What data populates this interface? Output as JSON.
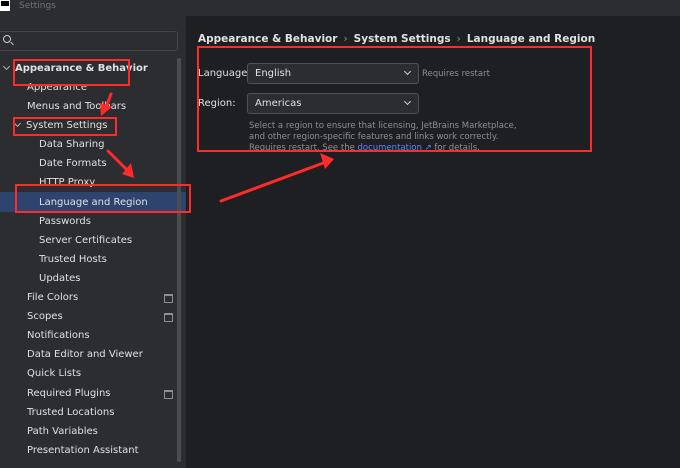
{
  "window": {
    "title": "Settings"
  },
  "search": {
    "placeholder": ""
  },
  "tree": {
    "appearance_behavior": "Appearance & Behavior",
    "appearance": "Appearance",
    "menus_toolbars": "Menus and Toolbars",
    "system_settings": "System Settings",
    "data_sharing": "Data Sharing",
    "date_formats": "Date Formats",
    "http_proxy": "HTTP Proxy",
    "language_region": "Language and Region",
    "passwords": "Passwords",
    "server_certificates": "Server Certificates",
    "trusted_hosts": "Trusted Hosts",
    "updates": "Updates",
    "file_colors": "File Colors",
    "scopes": "Scopes",
    "notifications": "Notifications",
    "data_editor_viewer": "Data Editor and Viewer",
    "quick_lists": "Quick Lists",
    "required_plugins": "Required Plugins",
    "trusted_locations": "Trusted Locations",
    "path_variables": "Path Variables",
    "presentation_assistant": "Presentation Assistant"
  },
  "breadcrumb": [
    "Appearance & Behavior",
    "System Settings",
    "Language and Region"
  ],
  "language": {
    "label": "Language:",
    "value": "English",
    "hint": "Requires restart"
  },
  "region": {
    "label": "Region:",
    "value": "Americas",
    "desc_before": "Select a region to ensure that licensing, JetBrains Marketplace, and other region-specific features and links work correctly. Requires restart. See the ",
    "link": "documentation ↗",
    "desc_after": " for details."
  },
  "colors": {
    "accent": "#2e436e",
    "annotation": "#ff2a2a",
    "link": "#548af7"
  }
}
